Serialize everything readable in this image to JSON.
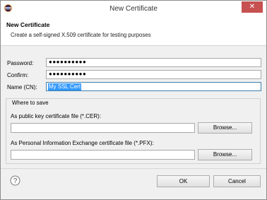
{
  "window": {
    "title": "New Certificate",
    "close_label": "✕"
  },
  "header": {
    "title": "New Certificate",
    "description": "Create a self-signed X.509 certificate for testing purposes"
  },
  "form": {
    "password_label": "Password:",
    "password_value": "●●●●●●●●●●",
    "confirm_label": "Confirm:",
    "confirm_value": "●●●●●●●●●●",
    "name_label": "Name (CN):",
    "name_value": "My SSL Cert"
  },
  "save_group": {
    "title": "Where to save",
    "cer_label": "As public key certificate file (*.CER):",
    "cer_value": "",
    "pfx_label": "As Personal Information Exchange certificate file (*.PFX):",
    "pfx_value": "",
    "browse_label": "Browse..."
  },
  "footer": {
    "ok_label": "OK",
    "cancel_label": "Cancel"
  },
  "icons": {
    "app": "eclipse-icon",
    "help": "help-icon"
  },
  "colors": {
    "selection": "#3399ff",
    "close_button": "#c75050"
  }
}
